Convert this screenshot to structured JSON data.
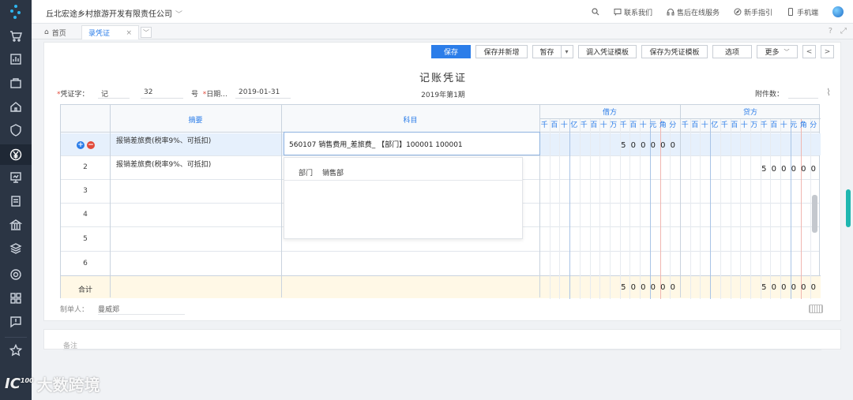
{
  "topbar": {
    "company": "丘北宏途乡村旅游开发有限责任公司",
    "links": [
      "联系我们",
      "售后在线服务",
      "新手指引",
      "手机端"
    ]
  },
  "tabs": {
    "home": "首页",
    "current": "录凭证"
  },
  "toolbar": {
    "save": "保存",
    "save_new": "保存并新增",
    "draft": "暂存",
    "import_template": "调入凭证模板",
    "save_template": "保存为凭证模板",
    "options": "选项",
    "more": "更多",
    "prev": "<",
    "next": ">"
  },
  "voucher": {
    "title": "记账凭证",
    "type_label": "凭证字：",
    "type_value": "记",
    "number_value": "32",
    "number_label": "号",
    "date_label": "日期...",
    "date_value": "2019-01-31",
    "period": "2019年第1期",
    "attach_label": "附件数："
  },
  "table": {
    "col_summary": "摘要",
    "col_account": "科目",
    "col_debit": "借方",
    "col_credit": "贷方",
    "digits": [
      "千",
      "百",
      "十",
      "亿",
      "千",
      "百",
      "十",
      "万",
      "千",
      "百",
      "十",
      "元",
      "角",
      "分"
    ],
    "rows": [
      {
        "no": "",
        "summary": "报销差旅费(税率9%、可抵扣)",
        "account": "560107 销售费用_差旅费_ 【部门】100001 100001",
        "debit": [
          "5",
          "0",
          "0",
          "0",
          "0",
          "0"
        ],
        "credit": []
      },
      {
        "no": "2",
        "summary": "报销差旅费(税率9%、可抵扣)",
        "account": "",
        "debit": [],
        "credit": [
          "5",
          "0",
          "0",
          "0",
          "0",
          "0"
        ]
      },
      {
        "no": "3",
        "summary": "",
        "account": "",
        "debit": [],
        "credit": []
      },
      {
        "no": "4",
        "summary": "",
        "account": "",
        "debit": [],
        "credit": []
      },
      {
        "no": "5",
        "summary": "",
        "account": "",
        "debit": [],
        "credit": []
      },
      {
        "no": "6",
        "summary": "",
        "account": "",
        "debit": [],
        "credit": []
      }
    ],
    "total_label": "合计",
    "total_debit": [
      "5",
      "0",
      "0",
      "0",
      "0",
      "0"
    ],
    "total_credit": [
      "5",
      "0",
      "0",
      "0",
      "0",
      "0"
    ],
    "aux_label": "部门",
    "aux_value": "销售部"
  },
  "footer": {
    "maker_label": "制单人：",
    "maker_value": "曼威郑",
    "note_label": "备注"
  },
  "watermark": {
    "text": "大数跨境",
    "mark": "IC",
    "sup": "100"
  },
  "colors": {
    "accent": "#2b7de9",
    "sidebar": "#2b3544",
    "danger": "#e24b3b"
  }
}
